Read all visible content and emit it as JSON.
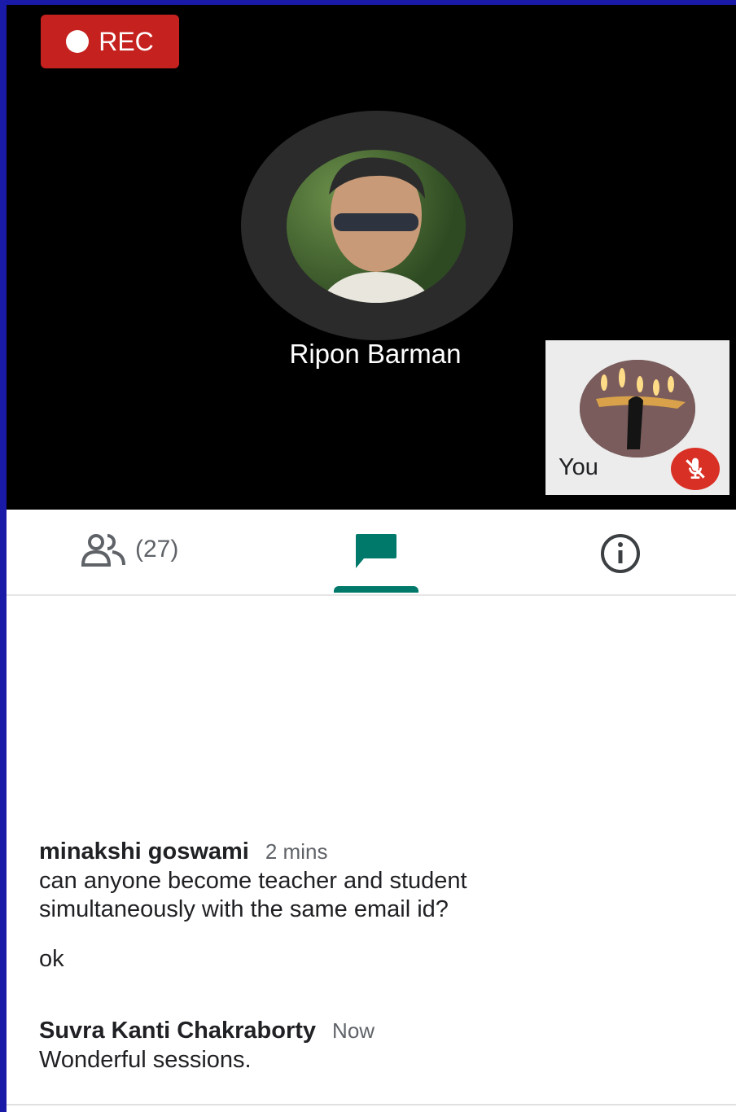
{
  "recording": {
    "label": "REC"
  },
  "speaker": {
    "name": "Ripon Barman"
  },
  "self_view": {
    "label": "You",
    "mic_status_icon": "mic-off-icon"
  },
  "tabs": [
    {
      "name": "people",
      "icon": "people-icon",
      "count": "(27)"
    },
    {
      "name": "chat",
      "icon": "chat-icon",
      "selected": true
    },
    {
      "name": "info",
      "icon": "info-icon"
    }
  ],
  "chat": {
    "messages": [
      {
        "sender": "minakshi goswami",
        "time": "2 mins",
        "lines": [
          "can anyone become teacher and student",
          "simultaneously with the same email id?"
        ],
        "followup": "ok"
      },
      {
        "sender": "Suvra Kanti Chakraborty",
        "time": "Now",
        "lines": [
          "Wonderful sessions."
        ]
      }
    ]
  },
  "colors": {
    "rec_red": "#c5221f",
    "mute_red": "#d93025",
    "accent_teal": "#00796b"
  }
}
